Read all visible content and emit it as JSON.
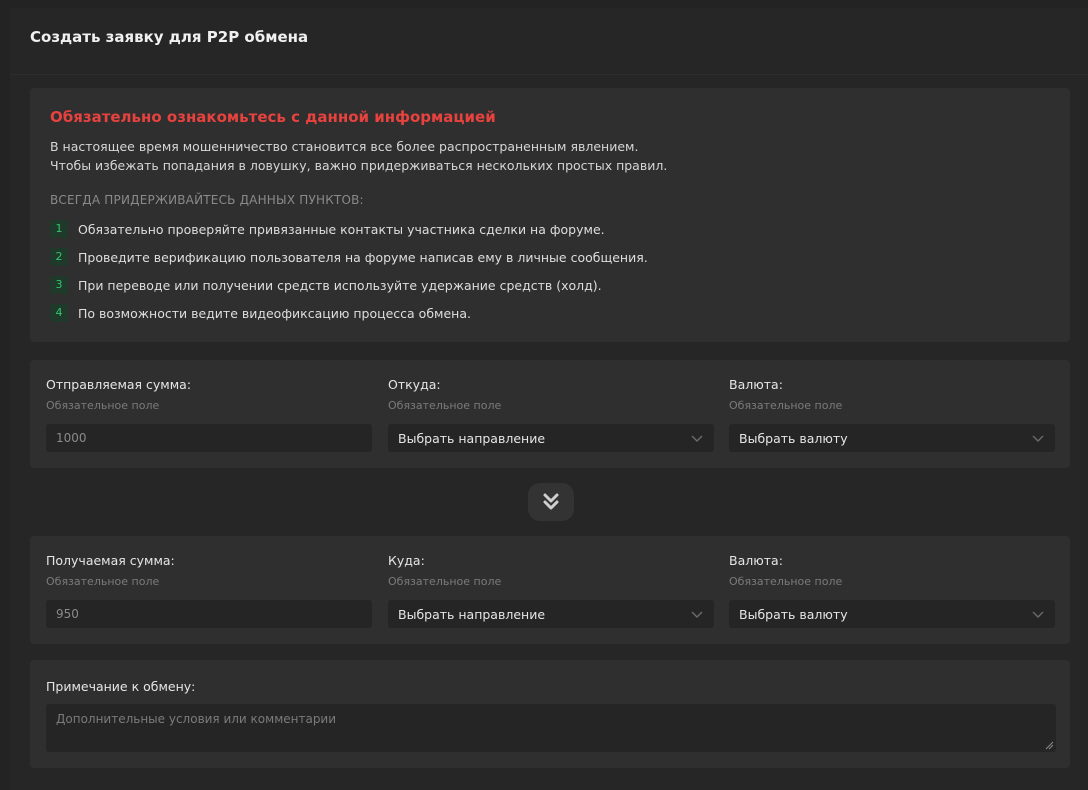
{
  "page": {
    "title": "Создать заявку для P2P обмена"
  },
  "info": {
    "title": "Обязательно ознакомьтесь с данной информацией",
    "text_line1": "В настоящее время мошенничество становится все более распространенным явлением.",
    "text_line2": "Чтобы избежать попадания в ловушку, важно придерживаться нескольких простых правил.",
    "subtitle": "ВСЕГДА ПРИДЕРЖИВАЙТЕСЬ ДАННЫХ ПУНКТОВ:",
    "rules": [
      {
        "num": "1",
        "text": "Обязательно проверяйте привязанные контакты участника сделки на форуме."
      },
      {
        "num": "2",
        "text": "Проведите верификацию пользователя на форуме написав ему в личные сообщения."
      },
      {
        "num": "3",
        "text": "При переводе или получении средств используйте удержание средств (холд)."
      },
      {
        "num": "4",
        "text": "По возможности ведите видеофиксацию процесса обмена."
      }
    ]
  },
  "send": {
    "amount_label": "Отправляемая сумма:",
    "amount_hint": "Обязательное поле",
    "amount_value": "1000",
    "from_label": "Откуда:",
    "from_hint": "Обязательное поле",
    "from_value": "Выбрать направление",
    "currency_label": "Валюта:",
    "currency_hint": "Обязательное поле",
    "currency_value": "Выбрать валюту"
  },
  "receive": {
    "amount_label": "Получаемая сумма:",
    "amount_hint": "Обязательное поле",
    "amount_value": "950",
    "to_label": "Куда:",
    "to_hint": "Обязательное поле",
    "to_value": "Выбрать направление",
    "currency_label": "Валюта:",
    "currency_hint": "Обязательное поле",
    "currency_value": "Выбрать валюту"
  },
  "note": {
    "label": "Примечание к обмену:",
    "placeholder": "Дополнительные условия или комментарии"
  },
  "colors": {
    "background": "#232323",
    "card": "#2f2f2f",
    "warning_title": "#e8423f",
    "rule_number": "#34c46e"
  },
  "icons": [
    "chevron-down-icon",
    "double-chevron-down-icon",
    "resize-grip-icon"
  ]
}
